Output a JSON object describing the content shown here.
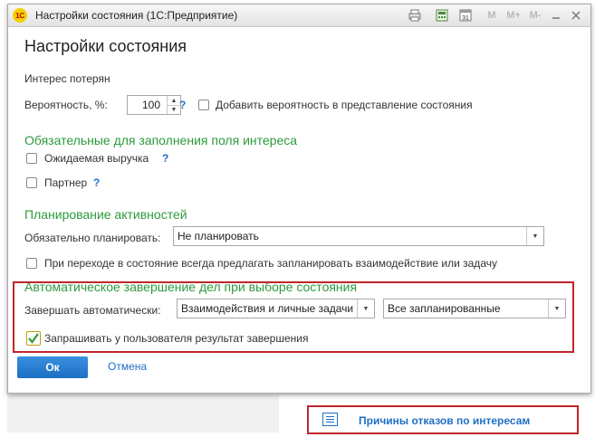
{
  "window": {
    "title": "Настройки состояния (1С:Предприятие)",
    "logo_text": "1С",
    "toolbar": {
      "m": "M",
      "m_plus": "M+",
      "m_minus": "M-",
      "calendar_day": "31"
    }
  },
  "form": {
    "heading": "Настройки состояния",
    "state_name": "Интерес потерян",
    "probability": {
      "label": "Вероятность, %:",
      "value": "100",
      "help": "?",
      "add_checkbox_label": "Добавить вероятность в представление состояния",
      "add_checked": false
    },
    "required_fields": {
      "heading": "Обязательные для заполнения поля интереса",
      "expected_revenue": {
        "label": "Ожидаемая выручка",
        "help": "?",
        "checked": false
      },
      "partner": {
        "label": "Партнер",
        "help": "?",
        "checked": false
      }
    },
    "planning": {
      "heading": "Планирование активностей",
      "mandatory_label": "Обязательно планировать:",
      "mandatory_value": "Не планировать",
      "suggest_label": "При переходе в состояние всегда предлагать  запланировать взаимодействие или задачу",
      "suggest_checked": false
    },
    "auto_complete": {
      "heading": "Автоматическое завершение дел при  выборе  состояния",
      "label": "Завершать автоматически:",
      "select1_value": "Взаимодействия и личные задачи",
      "select2_value": "Все запланированные",
      "ask_label": "Запрашивать у пользователя результат завершения",
      "ask_checked": true
    },
    "buttons": {
      "ok": "Ок",
      "cancel": "Отмена"
    }
  },
  "bottom_link": {
    "label": "Причины отказов по интересам",
    "icon": "list-icon"
  },
  "colors": {
    "accent_green": "#2d9a3c",
    "link_blue": "#1f6fc5",
    "highlight_red": "#c0262b",
    "ok_blue": "#1c6fc4"
  }
}
